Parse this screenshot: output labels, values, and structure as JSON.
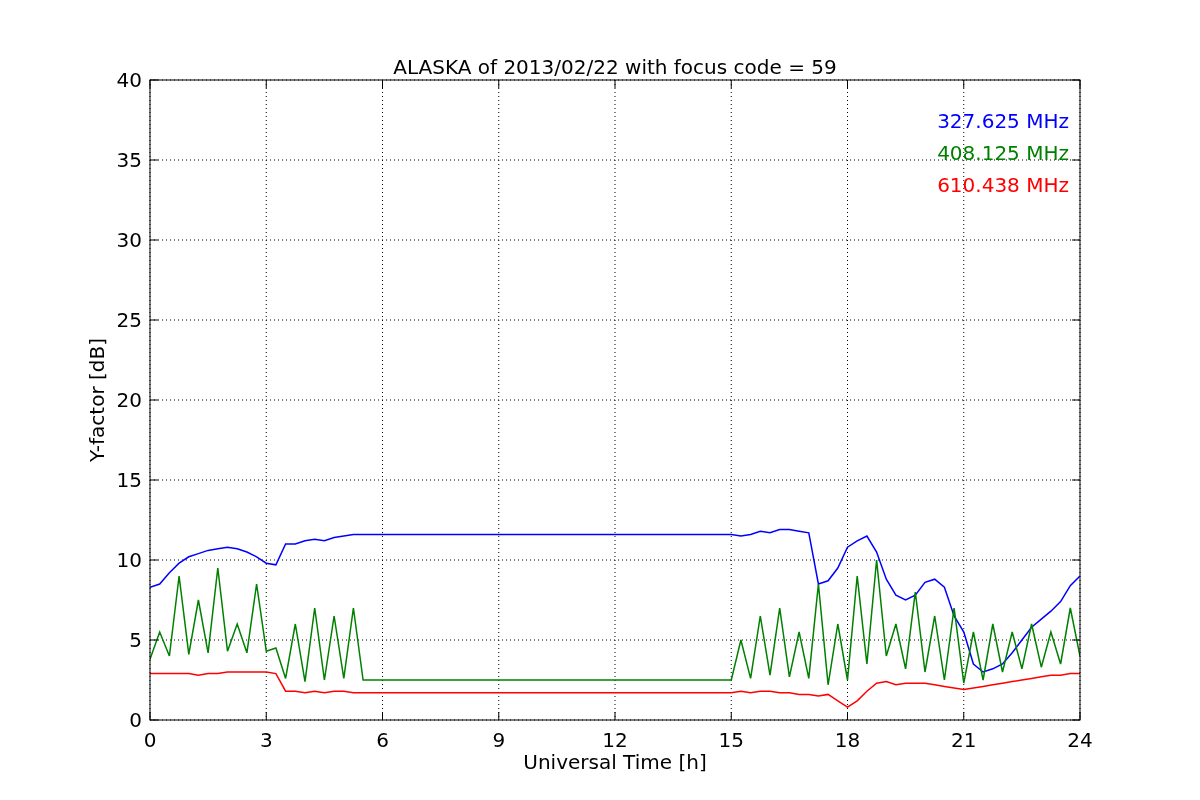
{
  "chart_data": {
    "type": "line",
    "title": "ALASKA of 2013/02/22 with focus code = 59",
    "xlabel": "Universal Time [h]",
    "ylabel": "Y-factor [dB]",
    "x": [
      0,
      0.25,
      0.5,
      0.75,
      1,
      1.25,
      1.5,
      1.75,
      2,
      2.25,
      2.5,
      2.75,
      3,
      3.25,
      3.5,
      3.75,
      4,
      4.25,
      4.5,
      4.75,
      5,
      5.25,
      5.5,
      15,
      15.25,
      15.5,
      15.75,
      16,
      16.25,
      16.5,
      16.75,
      17,
      17.25,
      17.5,
      17.75,
      18,
      18.25,
      18.5,
      18.75,
      19,
      19.25,
      19.5,
      19.75,
      20,
      20.25,
      20.5,
      20.75,
      21,
      21.25,
      21.5,
      21.75,
      22,
      22.25,
      22.5,
      22.75,
      23,
      23.25,
      23.5,
      23.75,
      24
    ],
    "series": [
      {
        "name": "327.625 MHz",
        "color": "#0000ff",
        "values": [
          8.3,
          8.5,
          9.2,
          9.8,
          10.2,
          10.4,
          10.6,
          10.7,
          10.8,
          10.7,
          10.5,
          10.2,
          9.8,
          9.7,
          11,
          11,
          11.2,
          11.3,
          11.2,
          11.4,
          11.5,
          11.6,
          11.6,
          11.6,
          11.5,
          11.6,
          11.8,
          11.7,
          11.9,
          11.9,
          11.8,
          11.7,
          8.5,
          8.7,
          9.5,
          10.8,
          11.2,
          11.5,
          10.5,
          8.8,
          7.8,
          7.5,
          7.8,
          8.6,
          8.8,
          8.3,
          6.5,
          5.5,
          3.5,
          3,
          3.2,
          3.5,
          4.2,
          5,
          5.8,
          6.3,
          6.8,
          7.4,
          8.4,
          9
        ]
      },
      {
        "name": "408.125 MHz",
        "color": "#008000",
        "values": [
          3.8,
          5.5,
          4,
          9,
          4.1,
          7.5,
          4.2,
          9.5,
          4.3,
          6,
          4.2,
          8.5,
          4.3,
          4.5,
          2.6,
          6,
          2.4,
          7,
          2.5,
          6.5,
          2.6,
          7,
          2.5,
          2.5,
          5,
          2.6,
          6.5,
          2.8,
          7,
          2.7,
          5.5,
          2.6,
          8.5,
          2.2,
          6,
          2.5,
          9,
          3.5,
          10,
          4,
          6,
          3.2,
          8,
          3,
          6.5,
          2.5,
          7,
          2.3,
          5.5,
          2.5,
          6,
          3,
          5.5,
          3.2,
          6,
          3.3,
          5.5,
          3.5,
          7,
          4
        ]
      },
      {
        "name": "610.438 MHz",
        "color": "#ff0000",
        "values": [
          2.9,
          2.9,
          2.9,
          2.9,
          2.9,
          2.8,
          2.9,
          2.9,
          3,
          3,
          3,
          3,
          3,
          2.9,
          1.8,
          1.8,
          1.7,
          1.8,
          1.7,
          1.8,
          1.8,
          1.7,
          1.7,
          1.7,
          1.8,
          1.7,
          1.8,
          1.8,
          1.7,
          1.7,
          1.6,
          1.6,
          1.5,
          1.6,
          1.2,
          0.8,
          1.2,
          1.8,
          2.3,
          2.4,
          2.2,
          2.3,
          2.3,
          2.3,
          2.2,
          2.1,
          2,
          1.9,
          2,
          2.1,
          2.2,
          2.3,
          2.4,
          2.5,
          2.6,
          2.7,
          2.8,
          2.8,
          2.9,
          2.9
        ]
      }
    ],
    "xlim": [
      0,
      24
    ],
    "ylim": [
      0,
      40
    ],
    "xticks": [
      0,
      3,
      6,
      9,
      12,
      15,
      18,
      21,
      24
    ],
    "yticks": [
      0,
      5,
      10,
      15,
      20,
      25,
      30,
      35,
      40
    ],
    "grid": true
  }
}
